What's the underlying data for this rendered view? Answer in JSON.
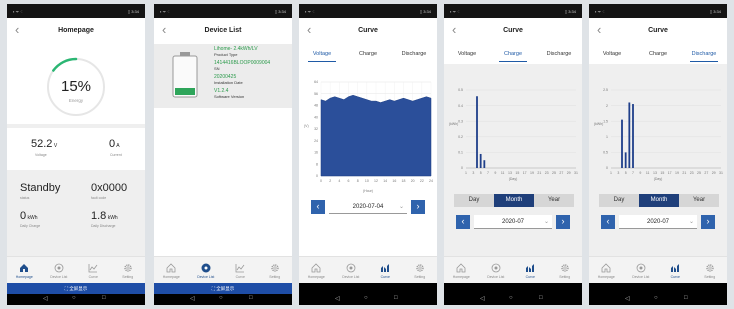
{
  "status_bar": {
    "left": "▪ ᯤ ⁖",
    "right": "▯ 3:34"
  },
  "homepage": {
    "title": "Homepage",
    "energy_percent": 15,
    "energy_value": "15%",
    "energy_label": "Energy",
    "voltage_value": "52.2",
    "voltage_unit": "V",
    "voltage_label": "Voltage",
    "current_value": "0",
    "current_unit": "A",
    "current_label": "Current",
    "status_value": "Standby",
    "status_label": "status",
    "fault_value": "0x0000",
    "fault_label": "fault code",
    "daily_charge_value": "0",
    "daily_charge_unit": "kWh",
    "daily_charge_label": "Daily Charge",
    "daily_discharge_value": "1.8",
    "daily_discharge_unit": "kWh",
    "daily_discharge_label": "Daily Discharge"
  },
  "device_list": {
    "title": "Device List",
    "product_type_value": "Lihome- 2.4kWh/LV",
    "product_type_label": "Product Type",
    "sn_value": "1414416BLOOP0009004",
    "sn_label": "SN",
    "install_date_value": "20200425",
    "install_date_label": "Installation Date",
    "software_value": "V1.2.4",
    "software_label": "Software Version"
  },
  "curve_title": "Curve",
  "curve_tabs": [
    "Voltage",
    "Charge",
    "Discharge"
  ],
  "period_tabs": [
    "Day",
    "Month",
    "Year"
  ],
  "voltage_curve": {
    "date": "2020-07-04",
    "y_axis_label": "(V)",
    "x_axis_label": "(Hour)",
    "x_ticks": [
      "0",
      "2",
      "4",
      "6",
      "8",
      "10",
      "12",
      "14",
      "16",
      "18",
      "20",
      "22",
      "24"
    ],
    "y_ticks": [
      "0",
      "8",
      "16",
      "24",
      "32",
      "40",
      "48",
      "56",
      "64"
    ]
  },
  "charge_curve": {
    "date": "2020-07",
    "y_axis_label": "(kWh)",
    "x_axis_label": "(Day)",
    "x_ticks": [
      "1",
      "3",
      "5",
      "7",
      "9",
      "11",
      "13",
      "15",
      "17",
      "19",
      "21",
      "23",
      "25",
      "27",
      "29",
      "31"
    ],
    "y_ticks": [
      "0",
      "0.1",
      "0.2",
      "0.3",
      "0.4",
      "0.5"
    ]
  },
  "discharge_curve": {
    "date": "2020-07",
    "y_axis_label": "(kWh)",
    "x_axis_label": "(Day)",
    "x_ticks": [
      "1",
      "3",
      "5",
      "7",
      "9",
      "11",
      "13",
      "15",
      "17",
      "19",
      "21",
      "23",
      "25",
      "27",
      "29",
      "31"
    ],
    "y_ticks": [
      "0",
      "0.5",
      "1",
      "1.5",
      "2",
      "2.5"
    ]
  },
  "tabs": [
    "Homepage",
    "Device List",
    "Curve",
    "Setting"
  ],
  "fullscreen_label": "全屏显示",
  "accent": "#1f5aa6",
  "chart_data": [
    {
      "type": "area",
      "title": "",
      "xlabel": "(Hour)",
      "ylabel": "(V)",
      "xlim": [
        0,
        24
      ],
      "ylim": [
        0,
        64
      ],
      "x": [
        0,
        1,
        2,
        3,
        4,
        5,
        6,
        7,
        8,
        9,
        10,
        11,
        12,
        13,
        14,
        15,
        16,
        17,
        18,
        19,
        20,
        21,
        22,
        23,
        24
      ],
      "values": [
        52,
        51,
        53,
        54,
        53,
        52,
        54,
        55,
        54,
        53,
        52,
        51,
        51,
        50,
        51,
        52,
        51,
        52,
        53,
        52,
        51,
        52,
        53,
        54,
        53
      ]
    },
    {
      "type": "bar",
      "title": "",
      "xlabel": "(Day)",
      "ylabel": "(kWh)",
      "ylim": [
        0,
        0.5
      ],
      "categories": [
        "1",
        "2",
        "3",
        "4",
        "5",
        "6",
        "7",
        "8",
        "9",
        "10",
        "11",
        "12",
        "13",
        "14",
        "15",
        "16",
        "17",
        "18",
        "19",
        "20",
        "21",
        "22",
        "23",
        "24",
        "25",
        "26",
        "27",
        "28",
        "29",
        "30",
        "31"
      ],
      "values": [
        0,
        0,
        0,
        0.46,
        0.09,
        0.05,
        0,
        0,
        0,
        0,
        0,
        0,
        0,
        0,
        0,
        0,
        0,
        0,
        0,
        0,
        0,
        0,
        0,
        0,
        0,
        0,
        0,
        0,
        0,
        0,
        0
      ]
    },
    {
      "type": "bar",
      "title": "",
      "xlabel": "(Day)",
      "ylabel": "(kWh)",
      "ylim": [
        0,
        2.5
      ],
      "categories": [
        "1",
        "2",
        "3",
        "4",
        "5",
        "6",
        "7",
        "8",
        "9",
        "10",
        "11",
        "12",
        "13",
        "14",
        "15",
        "16",
        "17",
        "18",
        "19",
        "20",
        "21",
        "22",
        "23",
        "24",
        "25",
        "26",
        "27",
        "28",
        "29",
        "30",
        "31"
      ],
      "values": [
        0,
        0,
        0,
        1.55,
        0.5,
        2.1,
        2.05,
        0,
        0,
        0,
        0,
        0,
        0,
        0,
        0,
        0,
        0,
        0,
        0,
        0,
        0,
        0,
        0,
        0,
        0,
        0,
        0,
        0,
        0,
        0,
        0
      ]
    }
  ]
}
